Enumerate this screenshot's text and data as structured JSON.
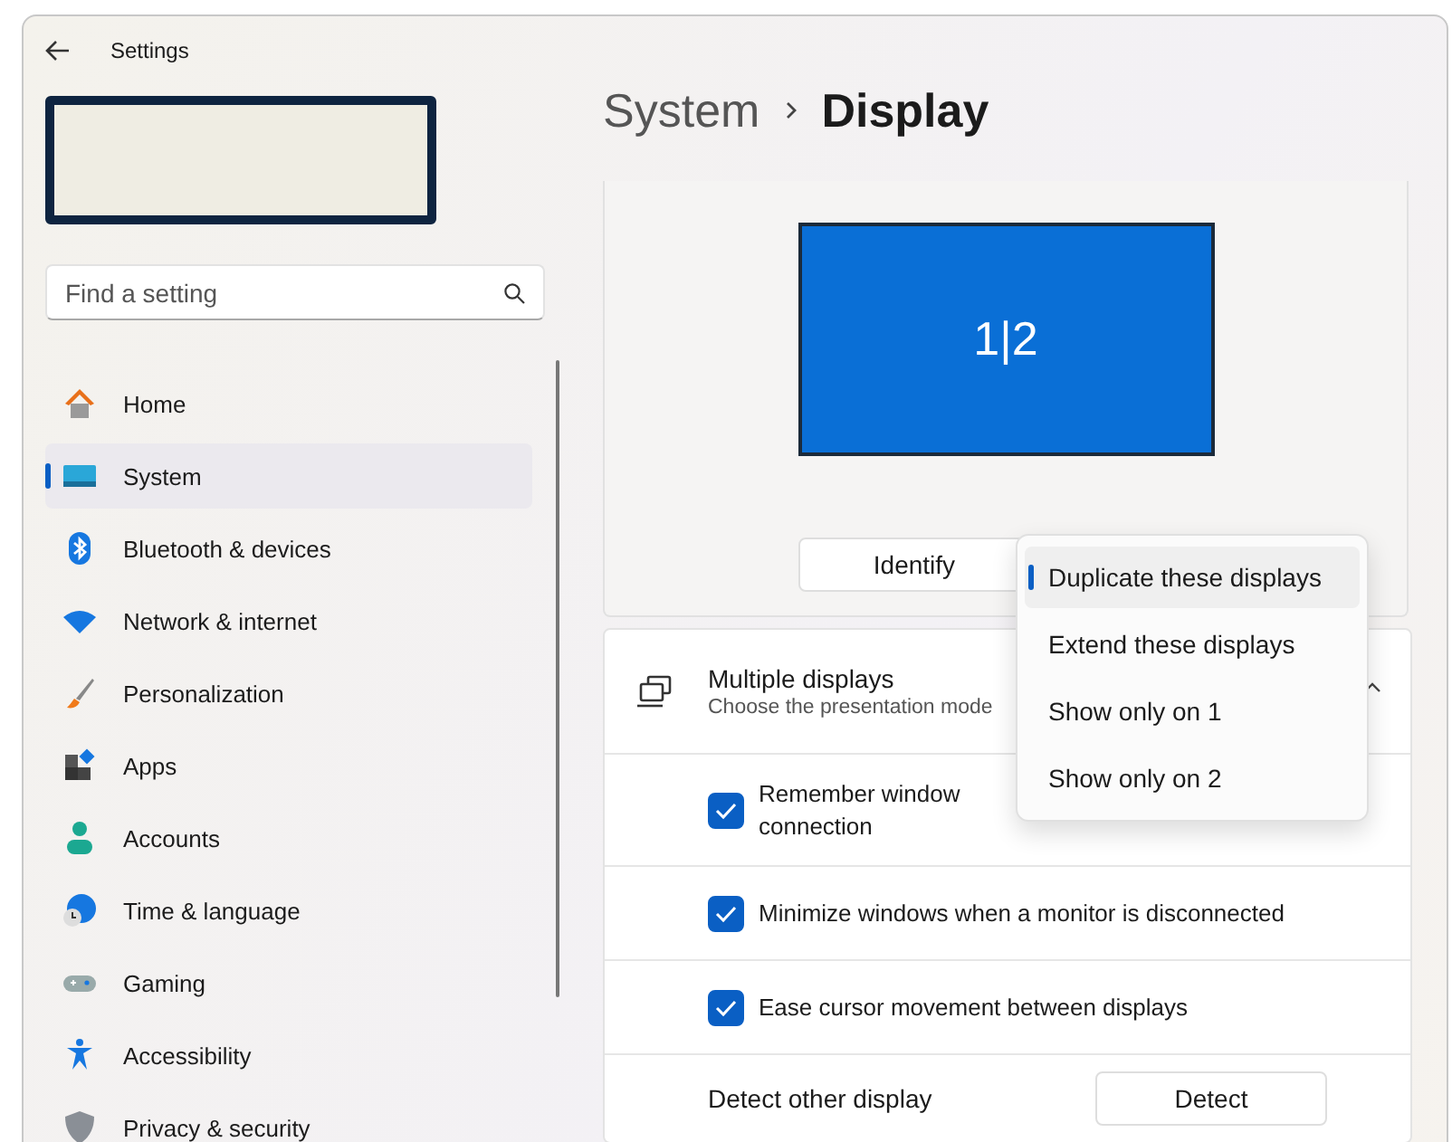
{
  "window": {
    "title": "Settings"
  },
  "search": {
    "placeholder": "Find a setting"
  },
  "sidebar": {
    "items": [
      {
        "label": "Home",
        "kind": "home",
        "selected": false
      },
      {
        "label": "System",
        "kind": "system",
        "selected": true
      },
      {
        "label": "Bluetooth & devices",
        "kind": "bluetooth",
        "selected": false
      },
      {
        "label": "Network & internet",
        "kind": "network",
        "selected": false
      },
      {
        "label": "Personalization",
        "kind": "brush",
        "selected": false
      },
      {
        "label": "Apps",
        "kind": "apps",
        "selected": false
      },
      {
        "label": "Accounts",
        "kind": "accounts",
        "selected": false
      },
      {
        "label": "Time & language",
        "kind": "time",
        "selected": false
      },
      {
        "label": "Gaming",
        "kind": "gaming",
        "selected": false
      },
      {
        "label": "Accessibility",
        "kind": "accessibility",
        "selected": false
      },
      {
        "label": "Privacy & security",
        "kind": "privacy",
        "selected": false
      }
    ]
  },
  "breadcrumb": {
    "parent": "System",
    "current": "Display"
  },
  "display_preview": {
    "label": "1|2",
    "identify_button": "Identify"
  },
  "mode_menu": {
    "options": [
      {
        "label": "Duplicate these displays",
        "selected": true
      },
      {
        "label": "Extend these displays",
        "selected": false
      },
      {
        "label": "Show only on 1",
        "selected": false
      },
      {
        "label": "Show only on 2",
        "selected": false
      }
    ]
  },
  "multiple_displays": {
    "title": "Multiple displays",
    "subtitle": "Choose the presentation mode",
    "expanded": true,
    "options": [
      {
        "lines": [
          "Remember window",
          "connection"
        ],
        "checked": true
      },
      {
        "lines": [
          "Minimize windows when a monitor is disconnected"
        ],
        "checked": true
      },
      {
        "lines": [
          "Ease cursor movement between displays"
        ],
        "checked": true
      }
    ],
    "detect": {
      "label": "Detect other display",
      "button": "Detect"
    }
  }
}
